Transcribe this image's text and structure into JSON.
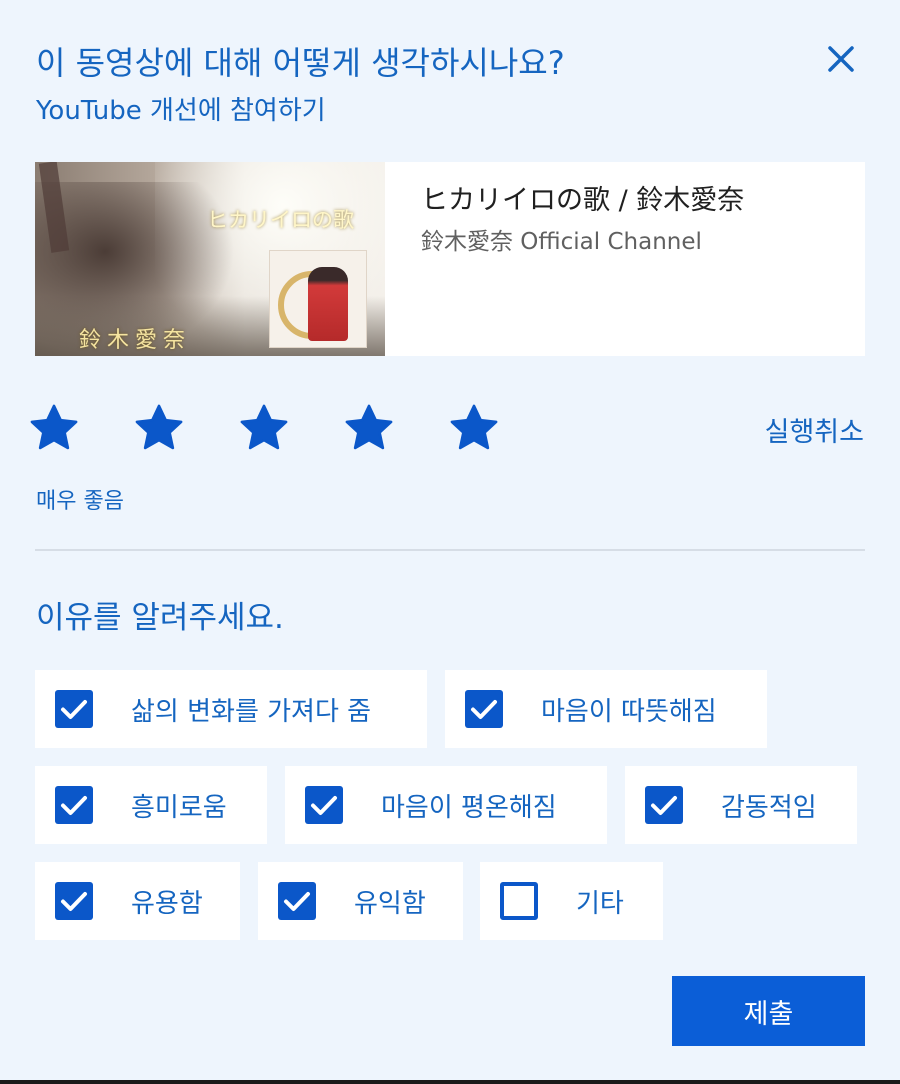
{
  "header": {
    "title": "이 동영상에 대해 어떻게 생각하시나요?",
    "subtitle": "YouTube 개선에 참여하기",
    "close_icon": "close-icon"
  },
  "video": {
    "title": "ヒカリイロの歌 / 鈴木愛奈",
    "channel": "鈴木愛奈 Official Channel",
    "thumbnail_title": "ヒカリイロの歌",
    "thumbnail_name": "鈴木愛奈"
  },
  "rating": {
    "stars_filled": 5,
    "stars_total": 5,
    "label": "매우 좋음",
    "undo_label": "실행취소",
    "star_color": "#0b57c9"
  },
  "reasons": {
    "heading": "이유를 알려주세요.",
    "options": [
      {
        "label": "삶의 변화를 가져다 줌",
        "checked": true
      },
      {
        "label": "마음이 따뜻해짐",
        "checked": true
      },
      {
        "label": "흥미로움",
        "checked": true
      },
      {
        "label": "마음이 평온해짐",
        "checked": true
      },
      {
        "label": "감동적임",
        "checked": true
      },
      {
        "label": "유용함",
        "checked": true
      },
      {
        "label": "유익함",
        "checked": true
      },
      {
        "label": "기타",
        "checked": false
      }
    ]
  },
  "submit_label": "제출",
  "colors": {
    "accent": "#1565c0",
    "button": "#0b5ed7",
    "background": "#eef5fd"
  }
}
